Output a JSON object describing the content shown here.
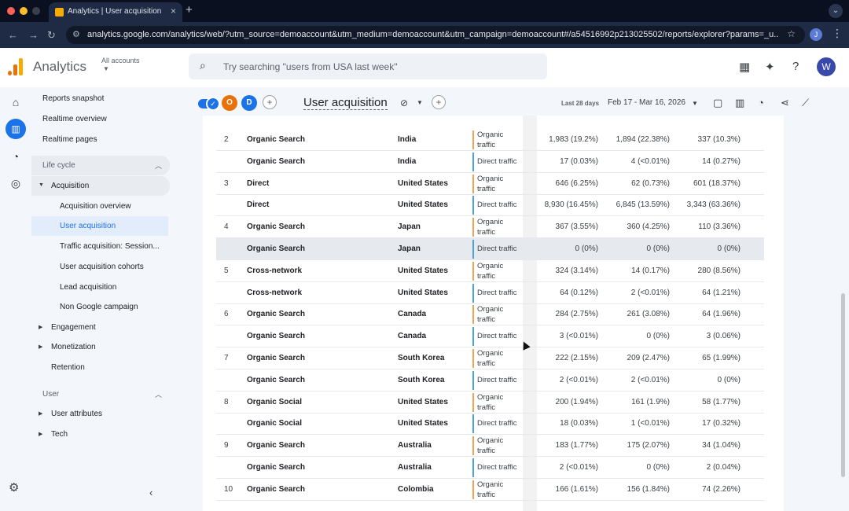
{
  "browser": {
    "tab_title": "Analytics | User acquisition",
    "url": "analytics.google.com/analytics/web/?utm_source=demoaccount&utm_medium=demoaccount&utm_campaign=demoaccount#/a54516992p213025502/reports/explorer?params=_u..na...",
    "profile_initial": "J"
  },
  "header": {
    "app_name": "Analytics",
    "account_label": "All accounts",
    "search_placeholder": "Try searching \"users from USA last week\"",
    "avatar_initial": "W"
  },
  "sidebar": {
    "top_items": [
      "Reports snapshot",
      "Realtime overview",
      "Realtime pages"
    ],
    "lifecycle_label": "Life cycle",
    "acquisition_label": "Acquisition",
    "acquisition_items": [
      "Acquisition overview",
      "User acquisition",
      "Traffic acquisition: Session...",
      "User acquisition cohorts",
      "Lead acquisition",
      "Non Google campaign"
    ],
    "lifecycle_rest": [
      "Engagement",
      "Monetization",
      "Retention"
    ],
    "user_label": "User",
    "user_items": [
      "User attributes",
      "Tech"
    ]
  },
  "report": {
    "title": "User acquisition",
    "comparison_o": "O",
    "comparison_d": "D",
    "date_label": "Last 28 days",
    "date_range": "Feb 17 - Mar 16, 2026"
  },
  "segment_colors": {
    "organic": "#f4a352",
    "direct": "#4aa3df"
  },
  "table": {
    "rows": [
      {
        "num": "2",
        "group": "Organic Search",
        "country": "India",
        "segment": [
          "Organic",
          "traffic"
        ],
        "seg_type": "organic",
        "m1": "1,983 (19.2%)",
        "m2": "1,894 (22.38%)",
        "m3": "337 (10.3%)",
        "hl": false
      },
      {
        "num": "",
        "group": "Organic Search",
        "country": "India",
        "segment": [
          "Direct traffic"
        ],
        "seg_type": "direct",
        "m1": "17 (0.03%)",
        "m2": "4 (<0.01%)",
        "m3": "14 (0.27%)",
        "hl": false
      },
      {
        "num": "3",
        "group": "Direct",
        "country": "United States",
        "segment": [
          "Organic",
          "traffic"
        ],
        "seg_type": "organic",
        "m1": "646 (6.25%)",
        "m2": "62 (0.73%)",
        "m3": "601 (18.37%)",
        "hl": false
      },
      {
        "num": "",
        "group": "Direct",
        "country": "United States",
        "segment": [
          "Direct traffic"
        ],
        "seg_type": "direct",
        "m1": "8,930 (16.45%)",
        "m2": "6,845 (13.59%)",
        "m3": "3,343 (63.36%)",
        "hl": false
      },
      {
        "num": "4",
        "group": "Organic Search",
        "country": "Japan",
        "segment": [
          "Organic",
          "traffic"
        ],
        "seg_type": "organic",
        "m1": "367 (3.55%)",
        "m2": "360 (4.25%)",
        "m3": "110 (3.36%)",
        "hl": false
      },
      {
        "num": "",
        "group": "Organic Search",
        "country": "Japan",
        "segment": [
          "Direct traffic"
        ],
        "seg_type": "direct",
        "m1": "0 (0%)",
        "m2": "0 (0%)",
        "m3": "0 (0%)",
        "hl": true
      },
      {
        "num": "5",
        "group": "Cross-network",
        "country": "United States",
        "segment": [
          "Organic",
          "traffic"
        ],
        "seg_type": "organic",
        "m1": "324 (3.14%)",
        "m2": "14 (0.17%)",
        "m3": "280 (8.56%)",
        "hl": false
      },
      {
        "num": "",
        "group": "Cross-network",
        "country": "United States",
        "segment": [
          "Direct traffic"
        ],
        "seg_type": "direct",
        "m1": "64 (0.12%)",
        "m2": "2 (<0.01%)",
        "m3": "64 (1.21%)",
        "hl": false
      },
      {
        "num": "6",
        "group": "Organic Search",
        "country": "Canada",
        "segment": [
          "Organic",
          "traffic"
        ],
        "seg_type": "organic",
        "m1": "284 (2.75%)",
        "m2": "261 (3.08%)",
        "m3": "64 (1.96%)",
        "hl": false
      },
      {
        "num": "",
        "group": "Organic Search",
        "country": "Canada",
        "segment": [
          "Direct traffic"
        ],
        "seg_type": "direct",
        "m1": "3 (<0.01%)",
        "m2": "0 (0%)",
        "m3": "3 (0.06%)",
        "hl": false
      },
      {
        "num": "7",
        "group": "Organic Search",
        "country": "South Korea",
        "segment": [
          "Organic",
          "traffic"
        ],
        "seg_type": "organic",
        "m1": "222 (2.15%)",
        "m2": "209 (2.47%)",
        "m3": "65 (1.99%)",
        "hl": false
      },
      {
        "num": "",
        "group": "Organic Search",
        "country": "South Korea",
        "segment": [
          "Direct traffic"
        ],
        "seg_type": "direct",
        "m1": "2 (<0.01%)",
        "m2": "2 (<0.01%)",
        "m3": "0 (0%)",
        "hl": false
      },
      {
        "num": "8",
        "group": "Organic Social",
        "country": "United States",
        "segment": [
          "Organic",
          "traffic"
        ],
        "seg_type": "organic",
        "m1": "200 (1.94%)",
        "m2": "161 (1.9%)",
        "m3": "58 (1.77%)",
        "hl": false
      },
      {
        "num": "",
        "group": "Organic Social",
        "country": "United States",
        "segment": [
          "Direct traffic"
        ],
        "seg_type": "direct",
        "m1": "18 (0.03%)",
        "m2": "1 (<0.01%)",
        "m3": "17 (0.32%)",
        "hl": false
      },
      {
        "num": "9",
        "group": "Organic Search",
        "country": "Australia",
        "segment": [
          "Organic",
          "traffic"
        ],
        "seg_type": "organic",
        "m1": "183 (1.77%)",
        "m2": "175 (2.07%)",
        "m3": "34 (1.04%)",
        "hl": false
      },
      {
        "num": "",
        "group": "Organic Search",
        "country": "Australia",
        "segment": [
          "Direct traffic"
        ],
        "seg_type": "direct",
        "m1": "2 (<0.01%)",
        "m2": "0 (0%)",
        "m3": "2 (0.04%)",
        "hl": false
      },
      {
        "num": "10",
        "group": "Organic Search",
        "country": "Colombia",
        "segment": [
          "Organic",
          "traffic"
        ],
        "seg_type": "organic",
        "m1": "166 (1.61%)",
        "m2": "156 (1.84%)",
        "m3": "74 (2.26%)",
        "hl": false
      }
    ]
  }
}
